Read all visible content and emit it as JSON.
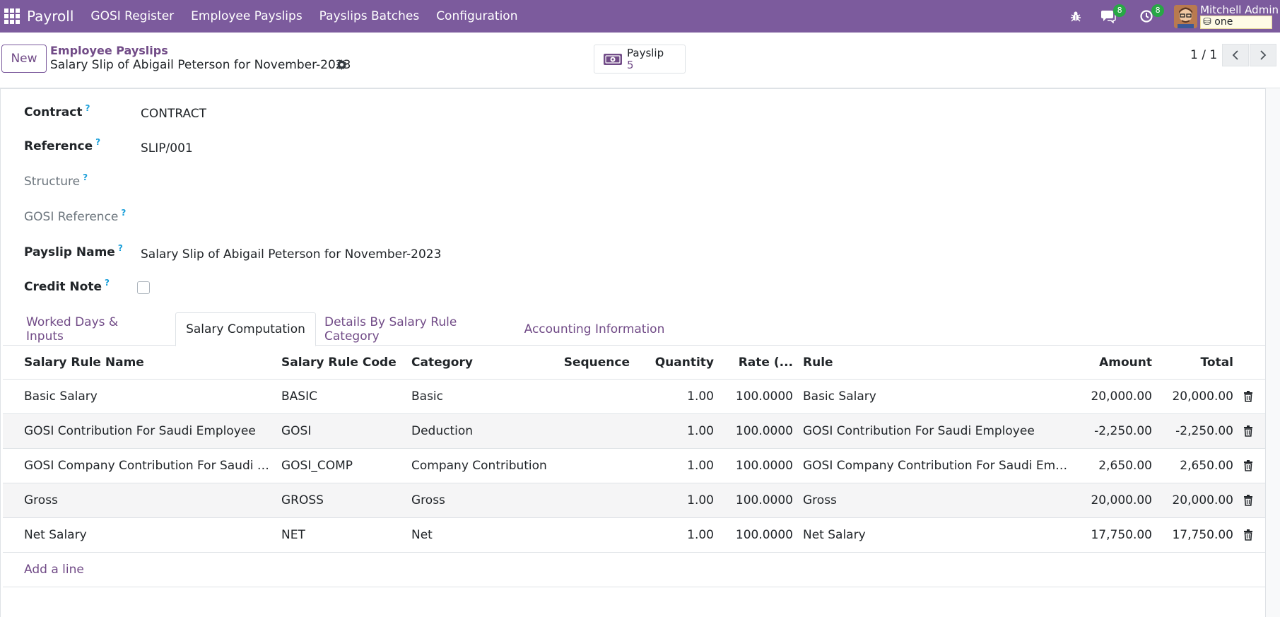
{
  "navbar": {
    "brand": "Payroll",
    "menu": [
      "GOSI Register",
      "Employee Payslips",
      "Payslips Batches",
      "Configuration"
    ],
    "messages_badge": "8",
    "activities_badge": "8",
    "user_name": "Mitchell Admin",
    "company": "one"
  },
  "control": {
    "new_label": "New",
    "breadcrumb_parent": "Employee Payslips",
    "breadcrumb_current": "Salary Slip of Abigail Peterson for November-2023",
    "smart_button_label": "Payslip",
    "smart_button_count": "5",
    "pager": "1 / 1"
  },
  "form": {
    "contract_label": "Contract",
    "contract_value": "CONTRACT",
    "reference_label": "Reference",
    "reference_value": "SLIP/001",
    "structure_label": "Structure",
    "gosi_reference_label": "GOSI Reference",
    "payslip_name_label": "Payslip Name",
    "payslip_name_value": "Salary Slip of Abigail Peterson for November-2023",
    "credit_note_label": "Credit Note",
    "qmark": "?"
  },
  "tabs": [
    "Worked Days & Inputs",
    "Salary Computation",
    "Details By Salary Rule Category",
    "Accounting Information"
  ],
  "table": {
    "headers": [
      "Salary Rule Name",
      "Salary Rule Code",
      "Category",
      "Sequence",
      "Quantity",
      "Rate (...",
      "Rule",
      "Amount",
      "Total"
    ],
    "rows": [
      {
        "name": "Basic Salary",
        "code": "BASIC",
        "category": "Basic",
        "sequence": "",
        "quantity": "1.00",
        "rate": "100.0000",
        "rule": "Basic Salary",
        "amount": "20,000.00",
        "total": "20,000.00"
      },
      {
        "name": "GOSI Contribution For Saudi Employee",
        "code": "GOSI",
        "category": "Deduction",
        "sequence": "",
        "quantity": "1.00",
        "rate": "100.0000",
        "rule": "GOSI Contribution For Saudi Employee",
        "amount": "-2,250.00",
        "total": "-2,250.00"
      },
      {
        "name": "GOSI Company Contribution For Saudi Em...",
        "code": "GOSI_COMP",
        "category": "Company Contribution",
        "sequence": "",
        "quantity": "1.00",
        "rate": "100.0000",
        "rule": "GOSI Company Contribution For Saudi Emplo...",
        "amount": "2,650.00",
        "total": "2,650.00"
      },
      {
        "name": "Gross",
        "code": "GROSS",
        "category": "Gross",
        "sequence": "",
        "quantity": "1.00",
        "rate": "100.0000",
        "rule": "Gross",
        "amount": "20,000.00",
        "total": "20,000.00"
      },
      {
        "name": "Net Salary",
        "code": "NET",
        "category": "Net",
        "sequence": "",
        "quantity": "1.00",
        "rate": "100.0000",
        "rule": "Net Salary",
        "amount": "17,750.00",
        "total": "17,750.00"
      }
    ],
    "add_line": "Add a line"
  }
}
